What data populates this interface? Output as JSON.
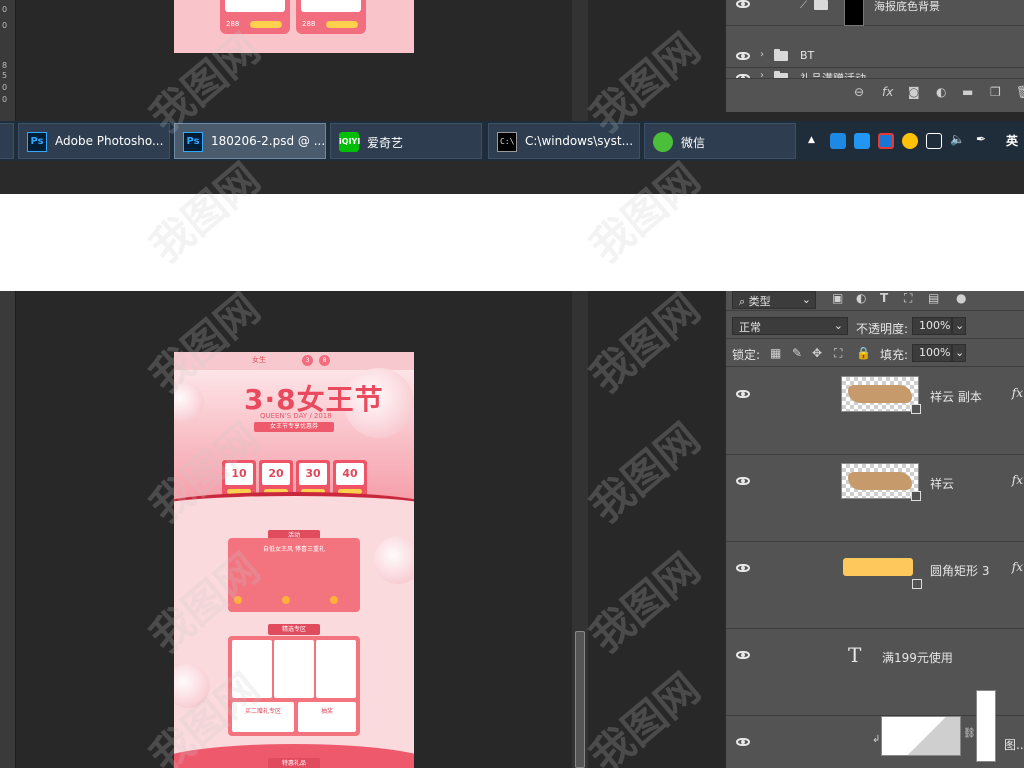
{
  "top_shot": {
    "ruler_ticks": [
      "0",
      "0",
      "8",
      "5",
      "0",
      "0"
    ],
    "doc_prices": [
      "288",
      "288"
    ],
    "layers": [
      {
        "name": "海报底色背景"
      },
      {
        "name": "BT"
      },
      {
        "name": "礼品满赠活动"
      }
    ],
    "layer_toolbar_icons": [
      "link-icon",
      "fx-icon",
      "mask-icon",
      "adjustment-icon",
      "folder-icon",
      "new-layer-icon",
      "trash-icon"
    ],
    "layer_toolbar_fx": "fx"
  },
  "taskbar": {
    "tasks": [
      {
        "label": "Adobe Photosho...",
        "icon": "photoshop-icon",
        "icon_text": "Ps",
        "active": false
      },
      {
        "label": "180206-2.psd @ ...",
        "icon": "photoshop-icon",
        "icon_text": "Ps",
        "active": true
      },
      {
        "label": "爱奇艺",
        "icon": "iqiyi-icon",
        "icon_text": "iQIYI",
        "active": false
      },
      {
        "label": "C:\\windows\\syst...",
        "icon": "cmd-icon",
        "icon_text": "C:\\",
        "active": false
      },
      {
        "label": "微信",
        "icon": "wechat-icon",
        "icon_text": "",
        "active": false
      }
    ],
    "tray": {
      "show_hidden": "▲",
      "ime": "英",
      "icons": [
        "mail-icon",
        "app-c-icon",
        "app-c2-icon",
        "color-ball-icon",
        "network-icon",
        "volume-icon",
        "pen-icon"
      ]
    }
  },
  "document": {
    "header_small_text": [
      "女生",
      "3",
      "8"
    ],
    "title": "3·8女王节",
    "subtitle": "QUEEN'S DAY / 2018",
    "ribbon": "女王节专享优惠券",
    "coupons": [
      "10",
      "20",
      "30",
      "40"
    ],
    "section1_tag": "活动",
    "section1_text": "自低女王风 悸喜三重礼",
    "section2_tag": "精选专区",
    "section2_card1": "买二赠礼专区",
    "section2_card2": "抽奖",
    "section3_tag": "特惠礼品"
  },
  "layers_panel": {
    "filter_label": "类型",
    "blend_mode": "正常",
    "opacity_label": "不透明度:",
    "opacity_value": "100%",
    "lock_label": "锁定:",
    "fill_label": "填充:",
    "fill_value": "100%",
    "layers": [
      {
        "name": "祥云 副本",
        "thumb": "cloud",
        "fx": "fx"
      },
      {
        "name": "祥云",
        "thumb": "cloud",
        "fx": "fx"
      },
      {
        "name": "圆角矩形 3",
        "thumb": "yellow",
        "fx": "fx"
      },
      {
        "name": "满199元使用",
        "thumb": "text",
        "fx": ""
      },
      {
        "name": "图...",
        "thumb": "mask",
        "fx": ""
      }
    ]
  },
  "watermark": "我图网",
  "colors": {
    "ps_blue": "#31a8ff",
    "panel_bg": "#535353",
    "canvas_bg": "#282828",
    "taskbar_bg": "#1f2c3a",
    "accent_red": "#ea4a5e"
  }
}
